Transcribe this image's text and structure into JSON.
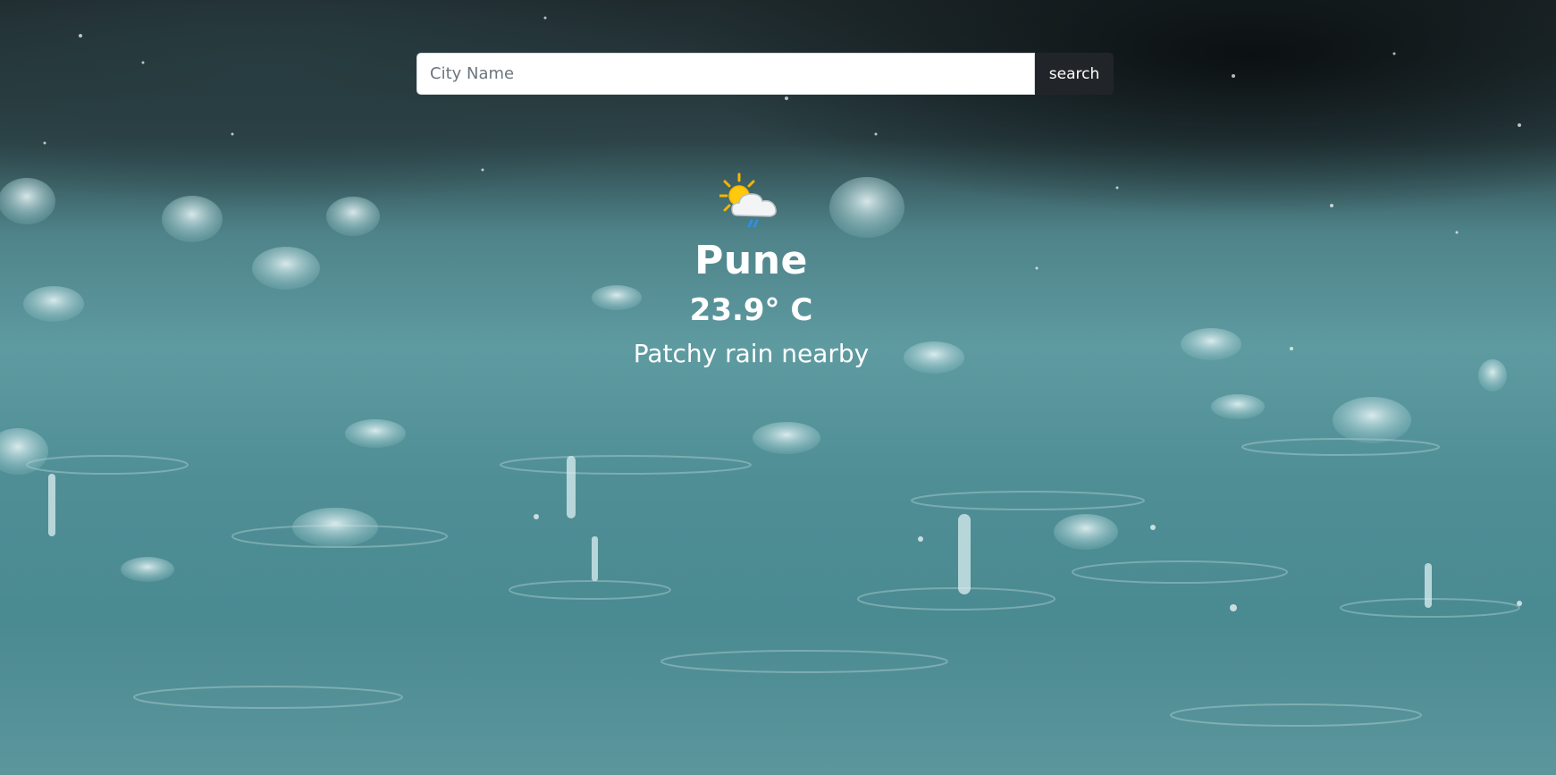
{
  "search": {
    "placeholder": "City Name",
    "value": "",
    "button_label": "search"
  },
  "weather": {
    "icon": "patchy-rain-sun-cloud-icon",
    "city": "Pune",
    "temperature": "23.9° C",
    "condition": "Patchy rain nearby"
  },
  "colors": {
    "search_button_bg": "#212529",
    "text": "#ffffff",
    "background_water": "#4f8e95"
  }
}
